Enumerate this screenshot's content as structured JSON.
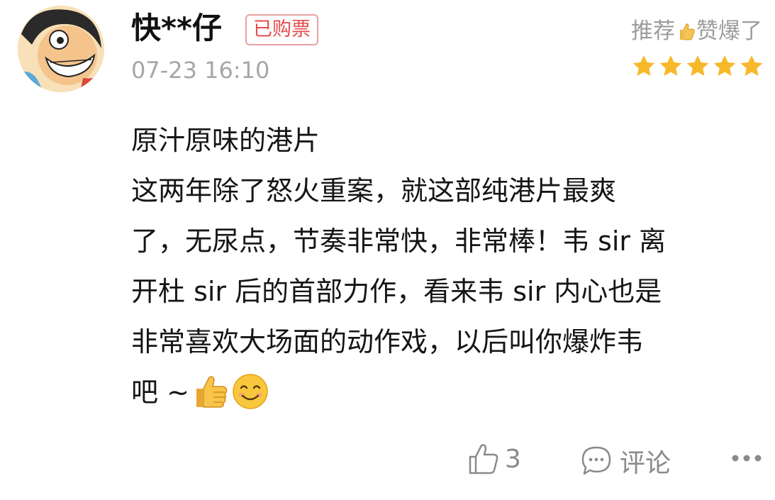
{
  "review": {
    "username": "快**仔",
    "badge": "已购票",
    "timestamp": "07-23 16:10",
    "rating": {
      "label_before": "推荐",
      "label_after": "赞爆了",
      "stars": 5,
      "max_stars": 5,
      "star_color": "#f7b82a"
    },
    "content_lines": [
      "原汁原味的港片",
      "这两年除了怒火重案，就这部纯港片最爽",
      "了，无尿点，节奏非常快，非常棒！韦 sir 离",
      "开杜 sir 后的首部力作，看来韦 sir 内心也是",
      "非常喜欢大场面的动作戏，以后叫你爆炸韦",
      "吧 ~"
    ],
    "actions": {
      "like_count": "3",
      "comment_label": "评论"
    }
  },
  "colors": {
    "badge_red": "#e64b4b",
    "muted_gray": "#9c9c9c",
    "timestamp_gray": "#a7a7a7"
  },
  "icons": {
    "avatar": "cartoon-avatar",
    "inline_thumb": "thumbs-up-emoji",
    "inline_smile": "smiling-face-emoji",
    "like": "thumbs-up-icon",
    "comment": "comment-bubble-icon",
    "more": "more-dots-icon"
  }
}
